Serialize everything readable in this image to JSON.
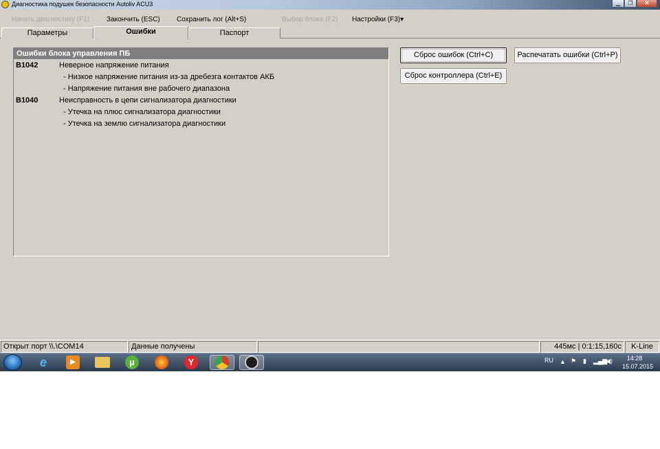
{
  "window": {
    "title": "Диагностика подушек безопасности Autoliv ACU3"
  },
  "menu": {
    "items": [
      {
        "label": "Начать диагностику (F1)",
        "enabled": false
      },
      {
        "label": "Закончить (ESC)",
        "enabled": true
      },
      {
        "label": "Сохранить лог (Alt+S)",
        "enabled": true
      },
      {
        "label": "Выбор блока (F2)",
        "enabled": false
      },
      {
        "label": "Настройки (F3)",
        "enabled": true
      }
    ],
    "dropdown_glyph": "▾"
  },
  "tabs": [
    {
      "label": "Параметры",
      "active": false
    },
    {
      "label": "Ошибки",
      "active": true
    },
    {
      "label": "Паспорт",
      "active": false
    }
  ],
  "errors_panel": {
    "header": "Ошибки блока управления ПБ",
    "rows": [
      {
        "code": "B1042",
        "text": "Неверное напряжение питания"
      },
      {
        "code": "",
        "text": "- Низкое напряжение питания из-за дребезга контактов АКБ"
      },
      {
        "code": "",
        "text": "- Напряжение питания вне рабочего диапазона"
      },
      {
        "code": "B1040",
        "text": "Неисправность в цепи сигнализатора диагностики"
      },
      {
        "code": "",
        "text": "- Утечка на плюс сигнализатора диагностики"
      },
      {
        "code": "",
        "text": "- Утечка на землю сигнализатора диагностики"
      }
    ]
  },
  "buttons": {
    "reset_errors": "Сброс ошибок (Ctrl+C)",
    "print_errors": "Распечатать ошибки (Ctrl+P)",
    "reset_controller": "Сброс контроллера (Ctrl+E)"
  },
  "statusbar": {
    "port": "Открыт порт \\\\.\\COM14",
    "data": "Данные получены",
    "timing": "445мс | 0:1:15,160с",
    "protocol": "K-Line"
  },
  "taskbar": {
    "language": "RU",
    "time": "14:28",
    "date": "15.07.2015",
    "pinned": [
      "ie-icon",
      "media-player-icon",
      "file-explorer-icon",
      "utorrent-icon",
      "firefox-icon",
      "yandex-browser-icon",
      "chrome-icon",
      "diagnostic-app-icon"
    ]
  }
}
